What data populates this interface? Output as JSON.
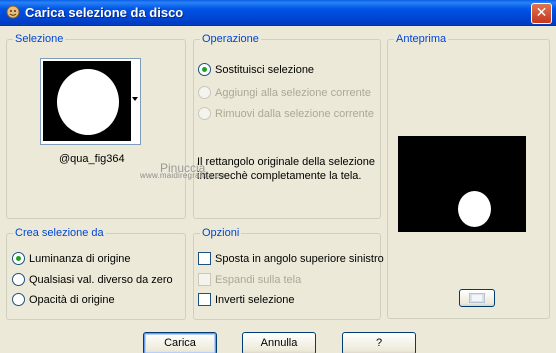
{
  "window": {
    "title": "Carica selezione da disco",
    "close_symbol": "✕"
  },
  "selezione": {
    "title": "Selezione",
    "file_name": "@qua_fig364"
  },
  "operazione": {
    "title": "Operazione",
    "options": [
      {
        "label": "Sostituisci selezione",
        "selected": true,
        "enabled": true
      },
      {
        "label": "Aggiungi alla selezione corrente",
        "selected": false,
        "enabled": false
      },
      {
        "label": "Rimuovi dalla selezione corrente",
        "selected": false,
        "enabled": false
      }
    ],
    "message_line1": "Il rettangolo originale della selezione",
    "message_line2": "intersechè completamente la tela."
  },
  "anteprima": {
    "title": "Anteprima"
  },
  "crea": {
    "title": "Crea selezione da",
    "options": [
      {
        "label": "Luminanza di origine",
        "selected": true
      },
      {
        "label": "Qualsiasi val. diverso da zero",
        "selected": false
      },
      {
        "label": "Opacità di origine",
        "selected": false
      }
    ]
  },
  "opzioni": {
    "title": "Opzioni",
    "options": [
      {
        "label": "Sposta in angolo superiore sinistro",
        "checked": false,
        "enabled": true
      },
      {
        "label": "Espandi sulla tela",
        "checked": false,
        "enabled": false
      },
      {
        "label": "Inverti selezione",
        "checked": false,
        "enabled": true
      }
    ]
  },
  "buttons": {
    "carica": "Carica",
    "annulla": "Annulla",
    "help": "?"
  },
  "watermark": {
    "name": "Pinuccia",
    "url": "www.maidiregrafica.eu"
  },
  "colors": {
    "title_bar": "#0055e5",
    "group_title": "#0046d5",
    "window_bg": "#ece9d8",
    "radio_selected": "#21a121"
  }
}
